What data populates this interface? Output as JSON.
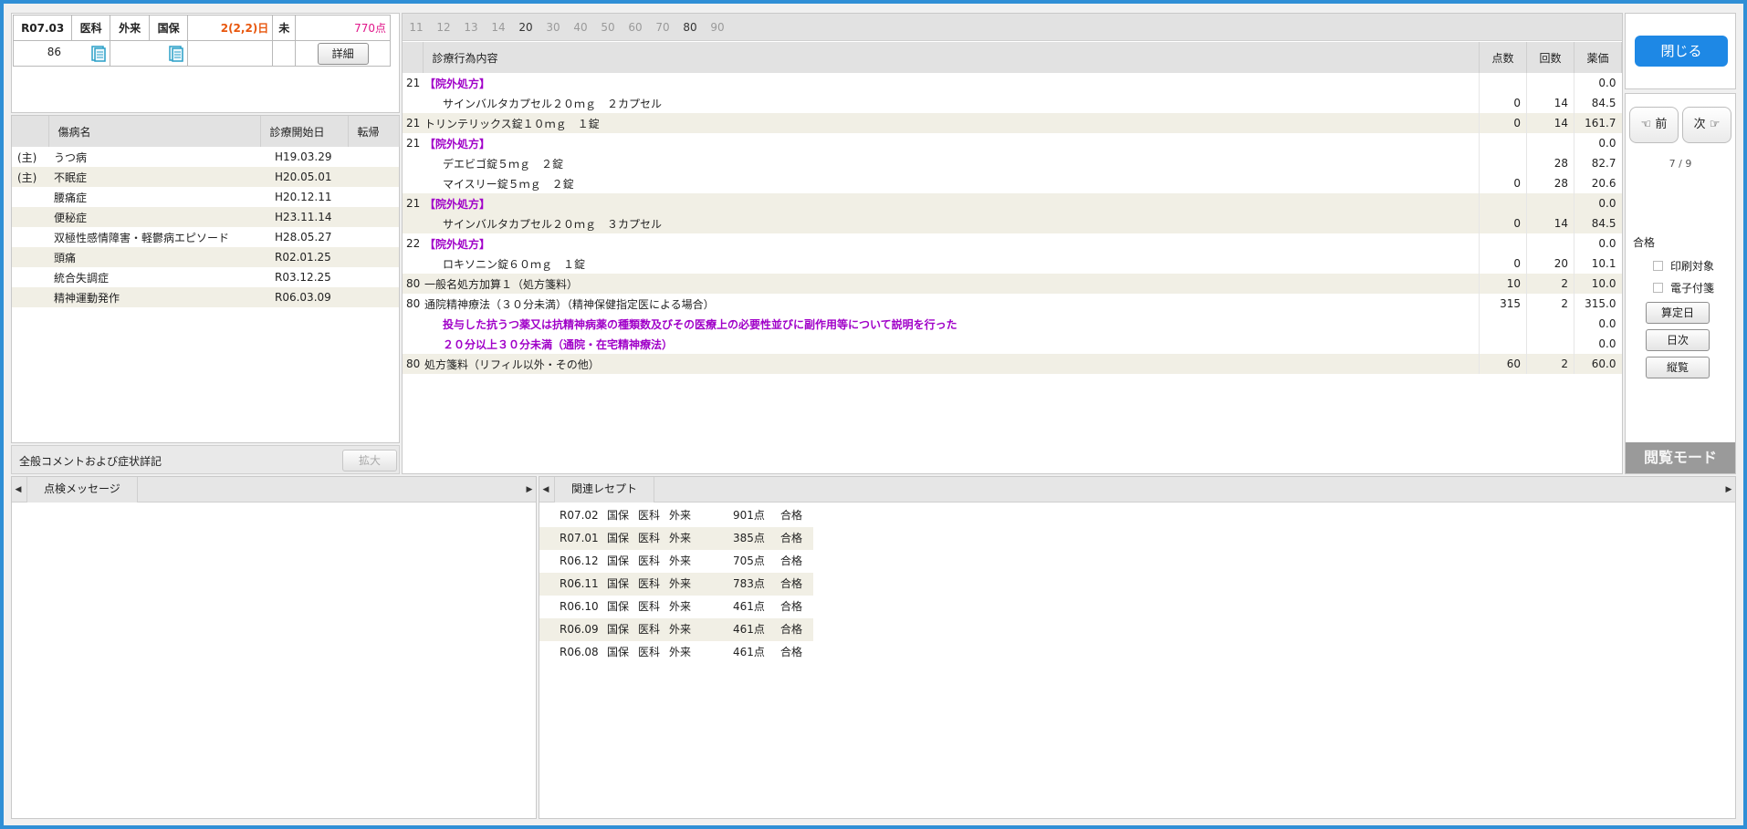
{
  "header": {
    "month": "R07.03",
    "dept": "医科",
    "visit_type": "外来",
    "insurance": "国保",
    "days": "2(2,2)日",
    "status": "未",
    "points": "770点",
    "row2_value": "86",
    "detail_button": "詳細"
  },
  "diseases": {
    "columns": [
      "傷病名",
      "診療開始日",
      "転帰"
    ],
    "rows": [
      {
        "mark": "(主)",
        "name": "うつ病",
        "date": "H19.03.29"
      },
      {
        "mark": "(主)",
        "name": "不眠症",
        "date": "H20.05.01"
      },
      {
        "mark": "",
        "name": "腰痛症",
        "date": "H20.12.11"
      },
      {
        "mark": "",
        "name": "便秘症",
        "date": "H23.11.14"
      },
      {
        "mark": "",
        "name": "双極性感情障害・軽鬱病エピソード",
        "date": "H28.05.27"
      },
      {
        "mark": "",
        "name": "頭痛",
        "date": "R02.01.25"
      },
      {
        "mark": "",
        "name": "統合失調症",
        "date": "R03.12.25"
      },
      {
        "mark": "",
        "name": "精神運動発作",
        "date": "R06.03.09"
      }
    ]
  },
  "comment": {
    "label": "全般コメントおよび症状詳記",
    "expand_button": "拡大"
  },
  "check_messages": {
    "tab_label": "点検メッセージ"
  },
  "related": {
    "tab_label": "関連レセプト",
    "rows": [
      {
        "month": "R07.02",
        "ins": "国保",
        "dept": "医科",
        "type": "外来",
        "points": "901点",
        "result": "合格"
      },
      {
        "month": "R07.01",
        "ins": "国保",
        "dept": "医科",
        "type": "外来",
        "points": "385点",
        "result": "合格"
      },
      {
        "month": "R06.12",
        "ins": "国保",
        "dept": "医科",
        "type": "外来",
        "points": "705点",
        "result": "合格"
      },
      {
        "month": "R06.11",
        "ins": "国保",
        "dept": "医科",
        "type": "外来",
        "points": "783点",
        "result": "合格"
      },
      {
        "month": "R06.10",
        "ins": "国保",
        "dept": "医科",
        "type": "外来",
        "points": "461点",
        "result": "合格"
      },
      {
        "month": "R06.09",
        "ins": "国保",
        "dept": "医科",
        "type": "外来",
        "points": "461点",
        "result": "合格"
      },
      {
        "month": "R06.08",
        "ins": "国保",
        "dept": "医科",
        "type": "外来",
        "points": "461点",
        "result": "合格"
      }
    ]
  },
  "number_tabs": [
    "11",
    "12",
    "13",
    "14",
    "20",
    "30",
    "40",
    "50",
    "60",
    "70",
    "80",
    "90"
  ],
  "active_number_tabs": [
    "20",
    "80"
  ],
  "treatments": {
    "columns": {
      "content": "診療行為内容",
      "points": "点数",
      "count": "回数",
      "price": "薬価"
    },
    "rows": [
      {
        "code": "21",
        "text": "【院外処方】",
        "kind": "purple",
        "points": "",
        "count": "",
        "price": "0.0",
        "alt": false
      },
      {
        "code": "",
        "text": "サインバルタカプセル２０ｍｇ　２カプセル",
        "kind": "",
        "points": "0",
        "count": "14",
        "price": "84.5",
        "alt": false
      },
      {
        "code": "21",
        "text": "トリンテリックス錠１０ｍｇ　１錠",
        "kind": "",
        "points": "0",
        "count": "14",
        "price": "161.7",
        "alt": true
      },
      {
        "code": "21",
        "text": "【院外処方】",
        "kind": "purple",
        "points": "",
        "count": "",
        "price": "0.0",
        "alt": false
      },
      {
        "code": "",
        "text": "デエビゴ錠５ｍｇ　２錠",
        "kind": "",
        "points": "",
        "count": "28",
        "price": "82.7",
        "alt": false
      },
      {
        "code": "",
        "text": "マイスリー錠５ｍｇ　２錠",
        "kind": "",
        "points": "0",
        "count": "28",
        "price": "20.6",
        "alt": false
      },
      {
        "code": "21",
        "text": "【院外処方】",
        "kind": "purple",
        "points": "",
        "count": "",
        "price": "0.0",
        "alt": true
      },
      {
        "code": "",
        "text": "サインバルタカプセル２０ｍｇ　３カプセル",
        "kind": "",
        "points": "0",
        "count": "14",
        "price": "84.5",
        "alt": true
      },
      {
        "code": "22",
        "text": "【院外処方】",
        "kind": "purple",
        "points": "",
        "count": "",
        "price": "0.0",
        "alt": false
      },
      {
        "code": "",
        "text": "ロキソニン錠６０ｍｇ　１錠",
        "kind": "",
        "points": "0",
        "count": "20",
        "price": "10.1",
        "alt": false
      },
      {
        "code": "80",
        "text": "一般名処方加算１（処方箋料）",
        "kind": "",
        "points": "10",
        "count": "2",
        "price": "10.0",
        "alt": true
      },
      {
        "code": "80",
        "text": "通院精神療法（３０分未満）（精神保健指定医による場合）",
        "kind": "",
        "points": "315",
        "count": "2",
        "price": "315.0",
        "alt": false
      },
      {
        "code": "",
        "text": "投与した抗うつ薬又は抗精神病薬の種類数及びその医療上の必要性並びに副作用等について説明を行った",
        "kind": "purple",
        "points": "",
        "count": "",
        "price": "0.0",
        "alt": false
      },
      {
        "code": "",
        "text": "２０分以上３０分未満（通院・在宅精神療法）",
        "kind": "purple",
        "points": "",
        "count": "",
        "price": "0.0",
        "alt": false
      },
      {
        "code": "80",
        "text": "処方箋料（リフィル以外・その他）",
        "kind": "",
        "points": "60",
        "count": "2",
        "price": "60.0",
        "alt": true
      }
    ]
  },
  "side": {
    "close_button": "閉じる",
    "prev_button": "前",
    "next_button": "次",
    "page_indicator": "7 / 9",
    "result": "合格",
    "print_target": "印刷対象",
    "e_attach": "電子付箋",
    "calc_day_button": "算定日",
    "daily_button": "日次",
    "vertical_button": "縦覧",
    "mode_label": "閲覧モード"
  },
  "colors": {
    "accent": "#1e88e5",
    "purple": "#a000c8",
    "orange": "#e8570e",
    "pink": "#e0178a",
    "alt_row": "#f1efe5"
  }
}
